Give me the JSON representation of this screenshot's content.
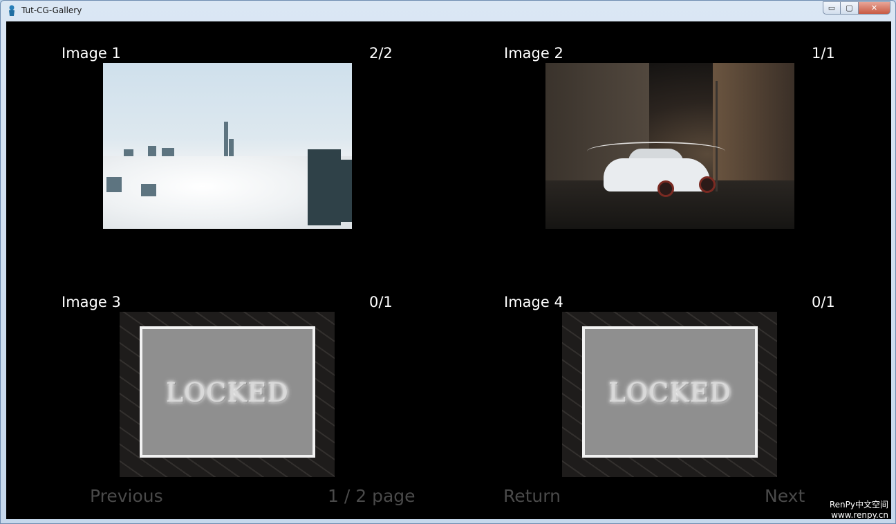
{
  "window": {
    "title": "Tut-CG-Gallery",
    "controls": {
      "minimize": "▭",
      "restore": "▢",
      "close": "✕"
    }
  },
  "gallery": {
    "items": [
      {
        "label": "Image 1",
        "count": "2/2",
        "state": "unlocked",
        "image": "city-in-clouds"
      },
      {
        "label": "Image 2",
        "count": "1/1",
        "state": "unlocked",
        "image": "white-car-at-night"
      },
      {
        "label": "Image 3",
        "count": "0/1",
        "state": "locked",
        "lock_text": "LOCKED"
      },
      {
        "label": "Image 4",
        "count": "0/1",
        "state": "locked",
        "lock_text": "LOCKED"
      }
    ]
  },
  "nav": {
    "previous": "Previous",
    "page": "1 / 2 page",
    "return": "Return",
    "next": "Next"
  },
  "watermark": {
    "line1": "RenPy中文空间",
    "line2": "www.renpy.cn"
  },
  "colors": {
    "background": "#000000",
    "label": "#ffffff",
    "nav_disabled": "#4a4a4a",
    "lock_fill": "#8f8f8f"
  }
}
